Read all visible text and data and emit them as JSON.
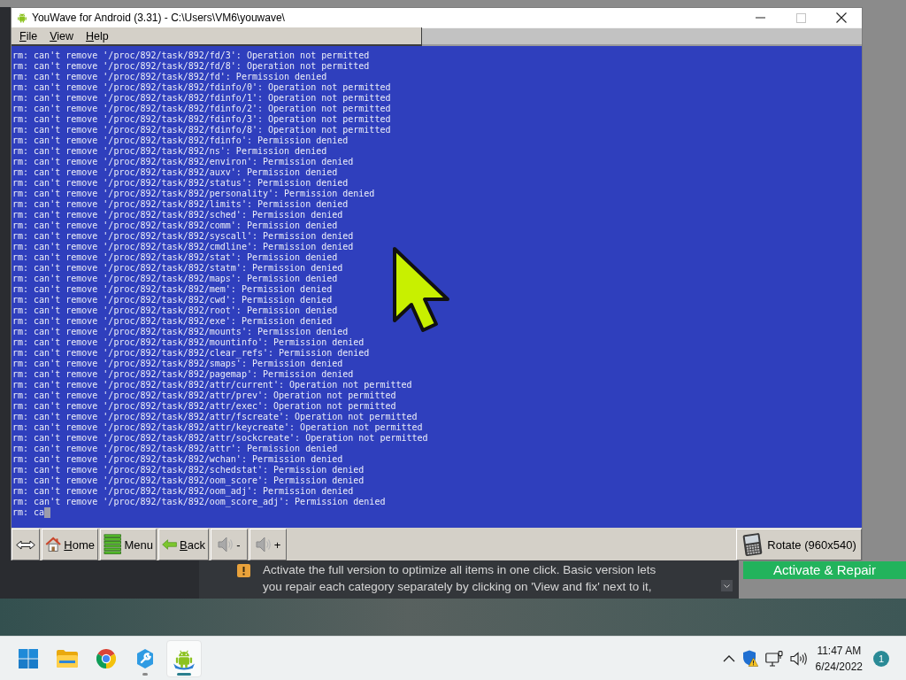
{
  "window": {
    "title": "YouWave for Android (3.31) - C:\\Users\\VM6\\youwave\\",
    "controls": [
      {
        "kind": "minimize",
        "disabled": false
      },
      {
        "kind": "maximize",
        "disabled": true
      },
      {
        "kind": "close",
        "disabled": false
      }
    ]
  },
  "menu": [
    {
      "label": "File",
      "mnemonic": true
    },
    {
      "label": "View",
      "mnemonic": true
    },
    {
      "label": "Help",
      "mnemonic": true
    }
  ],
  "terminal": {
    "lines": [
      "rm: can't remove '/proc/892/task/892/fd/3': Operation not permitted",
      "rm: can't remove '/proc/892/task/892/fd/8': Operation not permitted",
      "rm: can't remove '/proc/892/task/892/fd': Permission denied",
      "rm: can't remove '/proc/892/task/892/fdinfo/0': Operation not permitted",
      "rm: can't remove '/proc/892/task/892/fdinfo/1': Operation not permitted",
      "rm: can't remove '/proc/892/task/892/fdinfo/2': Operation not permitted",
      "rm: can't remove '/proc/892/task/892/fdinfo/3': Operation not permitted",
      "rm: can't remove '/proc/892/task/892/fdinfo/8': Operation not permitted",
      "rm: can't remove '/proc/892/task/892/fdinfo': Permission denied",
      "rm: can't remove '/proc/892/task/892/ns': Permission denied",
      "rm: can't remove '/proc/892/task/892/environ': Permission denied",
      "rm: can't remove '/proc/892/task/892/auxv': Permission denied",
      "rm: can't remove '/proc/892/task/892/status': Permission denied",
      "rm: can't remove '/proc/892/task/892/personality': Permission denied",
      "rm: can't remove '/proc/892/task/892/limits': Permission denied",
      "rm: can't remove '/proc/892/task/892/sched': Permission denied",
      "rm: can't remove '/proc/892/task/892/comm': Permission denied",
      "rm: can't remove '/proc/892/task/892/syscall': Permission denied",
      "rm: can't remove '/proc/892/task/892/cmdline': Permission denied",
      "rm: can't remove '/proc/892/task/892/stat': Permission denied",
      "rm: can't remove '/proc/892/task/892/statm': Permission denied",
      "rm: can't remove '/proc/892/task/892/maps': Permission denied",
      "rm: can't remove '/proc/892/task/892/mem': Permission denied",
      "rm: can't remove '/proc/892/task/892/cwd': Permission denied",
      "rm: can't remove '/proc/892/task/892/root': Permission denied",
      "rm: can't remove '/proc/892/task/892/exe': Permission denied",
      "rm: can't remove '/proc/892/task/892/mounts': Permission denied",
      "rm: can't remove '/proc/892/task/892/mountinfo': Permission denied",
      "rm: can't remove '/proc/892/task/892/clear_refs': Permission denied",
      "rm: can't remove '/proc/892/task/892/smaps': Permission denied",
      "rm: can't remove '/proc/892/task/892/pagemap': Permission denied",
      "rm: can't remove '/proc/892/task/892/attr/current': Operation not permitted",
      "rm: can't remove '/proc/892/task/892/attr/prev': Operation not permitted",
      "rm: can't remove '/proc/892/task/892/attr/exec': Operation not permitted",
      "rm: can't remove '/proc/892/task/892/attr/fscreate': Operation not permitted",
      "rm: can't remove '/proc/892/task/892/attr/keycreate': Operation not permitted",
      "rm: can't remove '/proc/892/task/892/attr/sockcreate': Operation not permitted",
      "rm: can't remove '/proc/892/task/892/attr': Permission denied",
      "rm: can't remove '/proc/892/task/892/wchan': Permission denied",
      "rm: can't remove '/proc/892/task/892/schedstat': Permission denied",
      "rm: can't remove '/proc/892/task/892/oom_score': Permission denied",
      "rm: can't remove '/proc/892/task/892/oom_adj': Permission denied",
      "rm: can't remove '/proc/892/task/892/oom_score_adj': Permission denied"
    ],
    "input": "rm: ca"
  },
  "toolbar": {
    "left_buttons": [
      {
        "kind": "resize"
      },
      {
        "kind": "home",
        "label": "Home",
        "mnemonic": true
      },
      {
        "kind": "menu",
        "label": "Menu",
        "mnemonic": false
      },
      {
        "kind": "back",
        "label": "Back",
        "mnemonic": true
      },
      {
        "kind": "volume-down",
        "label": "-",
        "mnemonic": false
      },
      {
        "kind": "volume-up",
        "label": "+",
        "mnemonic": false
      }
    ],
    "right_buttons": [
      {
        "kind": "rotate",
        "label": "Rotate (960x540)",
        "mnemonic": false
      }
    ]
  },
  "background_app": {
    "notice_lines": [
      "Activate the full version to optimize all items in one click. Basic version lets",
      "you repair each category separately by clicking on 'View and fix' next to it,"
    ],
    "button": "Activate & Repair"
  },
  "taskbar": {
    "apps": [
      {
        "kind": "start",
        "selected": false,
        "running": false
      },
      {
        "kind": "folder",
        "selected": false,
        "running": false
      },
      {
        "kind": "browser",
        "selected": false,
        "running": false
      },
      {
        "kind": "wrench",
        "selected": false,
        "running": true
      },
      {
        "kind": "android",
        "selected": true,
        "running": true
      }
    ],
    "tray": [
      {
        "kind": "chevron"
      },
      {
        "kind": "shield"
      },
      {
        "kind": "network"
      },
      {
        "kind": "volume"
      }
    ],
    "time": "11:47 AM",
    "date": "6/24/2022",
    "notifications": "1"
  }
}
